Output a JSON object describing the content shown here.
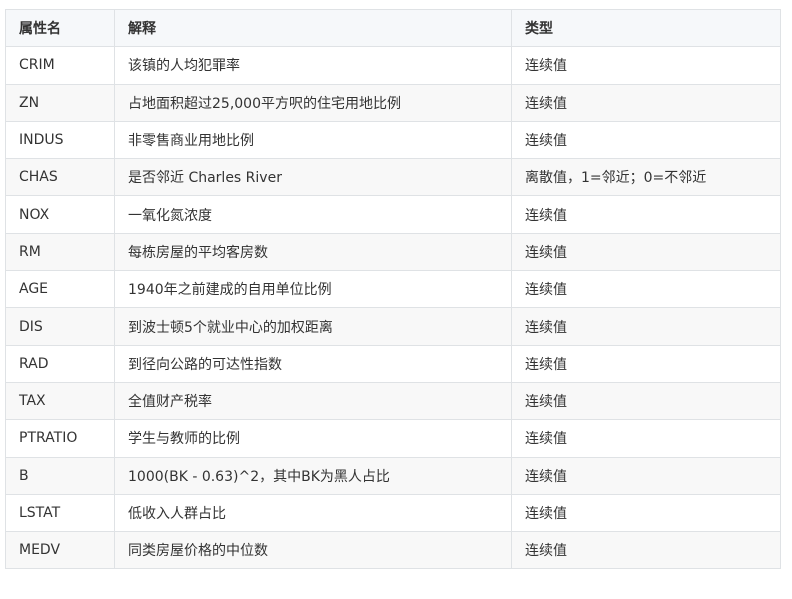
{
  "table": {
    "headers": [
      "属性名",
      "解释",
      "类型"
    ],
    "rows": [
      [
        "CRIM",
        "该镇的人均犯罪率",
        "连续值"
      ],
      [
        "ZN",
        "占地面积超过25,000平方呎的住宅用地比例",
        "连续值"
      ],
      [
        "INDUS",
        "非零售商业用地比例",
        "连续值"
      ],
      [
        "CHAS",
        "是否邻近 Charles River",
        "离散值，1=邻近；0=不邻近"
      ],
      [
        "NOX",
        "一氧化氮浓度",
        "连续值"
      ],
      [
        "RM",
        "每栋房屋的平均客房数",
        "连续值"
      ],
      [
        "AGE",
        "1940年之前建成的自用单位比例",
        "连续值"
      ],
      [
        "DIS",
        "到波士顿5个就业中心的加权距离",
        "连续值"
      ],
      [
        "RAD",
        "到径向公路的可达性指数",
        "连续值"
      ],
      [
        "TAX",
        "全值财产税率",
        "连续值"
      ],
      [
        "PTRATIO",
        "学生与教师的比例",
        "连续值"
      ],
      [
        "B",
        "1000(BK - 0.63)^2，其中BK为黑人占比",
        "连续值"
      ],
      [
        "LSTAT",
        "低收入人群占比",
        "连续值"
      ],
      [
        "MEDV",
        "同类房屋价格的中位数",
        "连续值"
      ]
    ]
  }
}
